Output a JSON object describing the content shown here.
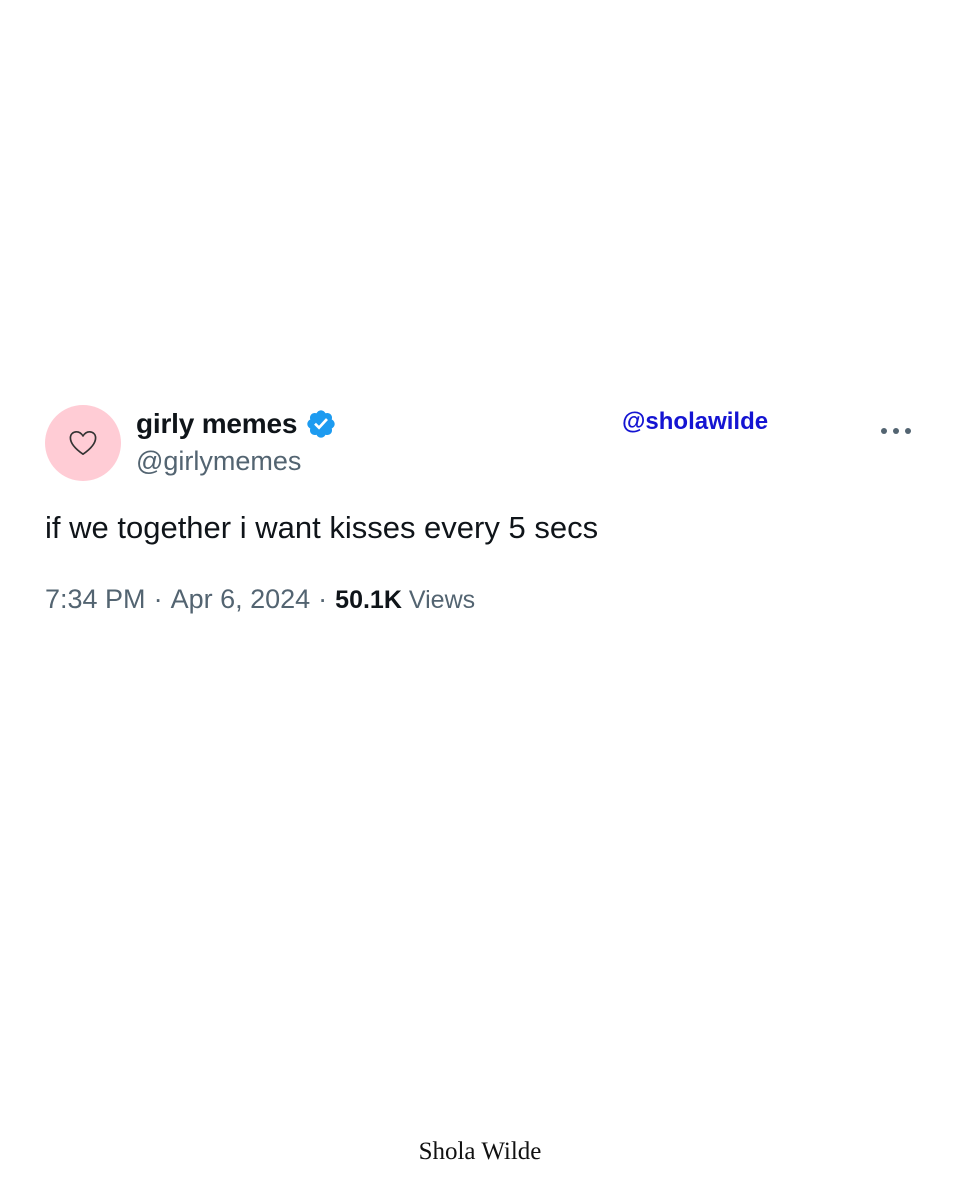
{
  "tweet": {
    "display_name": "girly memes",
    "handle": "@girlymemes",
    "text": "if we together i want kisses every 5 secs",
    "time": "7:34 PM",
    "separator": "·",
    "date": "Apr 6, 2024",
    "views_count": "50.1K",
    "views_label": "Views",
    "avatar_icon": "heart-outline-icon",
    "verified_icon": "verified-badge-icon",
    "more_icon": "more-dots-icon"
  },
  "watermark": {
    "handle": "@sholawilde",
    "signature": "Shola Wilde"
  },
  "colors": {
    "avatar_bg": "#ffccd5",
    "verified": "#1d9bf0",
    "secondary_text": "#536471",
    "primary_text": "#0f1419",
    "watermark": "#1414d2"
  }
}
